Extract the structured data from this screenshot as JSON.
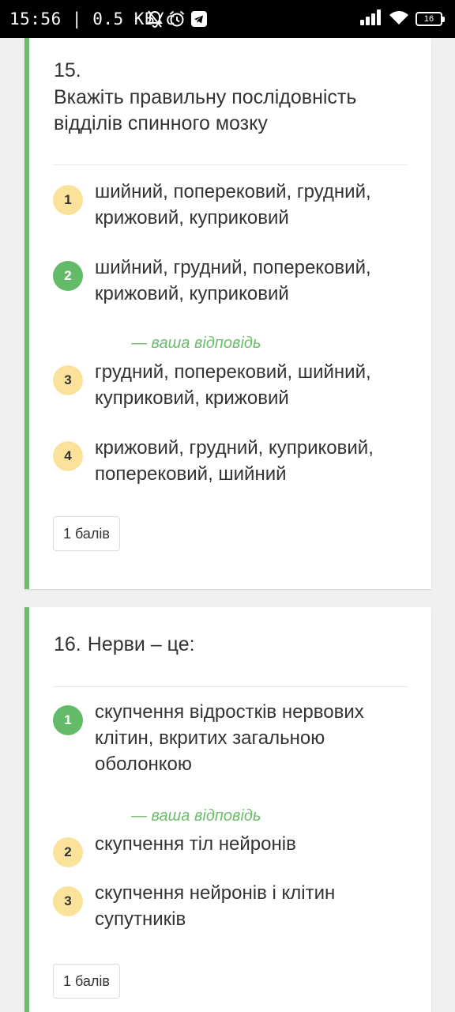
{
  "status_bar": {
    "time": "15:56",
    "separator": "|",
    "speed": "0.5 КБ/с",
    "battery": "16",
    "icons": [
      "mute-bell-icon",
      "alarm-clock-icon",
      "telegram-icon",
      "signal-icon",
      "wifi-icon",
      "battery-icon"
    ]
  },
  "questions": [
    {
      "number": "15.",
      "text": "Вкажіть правильну послідовність відділів спинного мозку",
      "options": [
        {
          "num": "1",
          "text": "шийний, поперековий, грудний, крижовий, куприковий"
        },
        {
          "num": "2",
          "text": "шийний, грудний, поперековий, крижовий, куприковий",
          "selected": true
        },
        {
          "num": "3",
          "text": "грудний, поперековий, шийний, куприковий, крижовий"
        },
        {
          "num": "4",
          "text": "крижовий, грудний, куприковий, поперековий, шийний"
        }
      ],
      "your_answer_label": "— ваша відповідь",
      "points": "1 балів"
    },
    {
      "number": "16.",
      "text": "Нерви – це:",
      "options": [
        {
          "num": "1",
          "text": "скупчення відростків нервових клітин, вкритих загальною оболонкою",
          "selected": true
        },
        {
          "num": "2",
          "text": "скупчення тіл нейронів"
        },
        {
          "num": "3",
          "text": "скупчення нейронів і клітин супутників"
        }
      ],
      "your_answer_label": "— ваша відповідь",
      "points": "1 балів"
    }
  ],
  "colors": {
    "accent_green": "#6cbd6b",
    "correct_circle": "#63ba68",
    "option_circle": "#fbe29a",
    "text": "#333333"
  }
}
